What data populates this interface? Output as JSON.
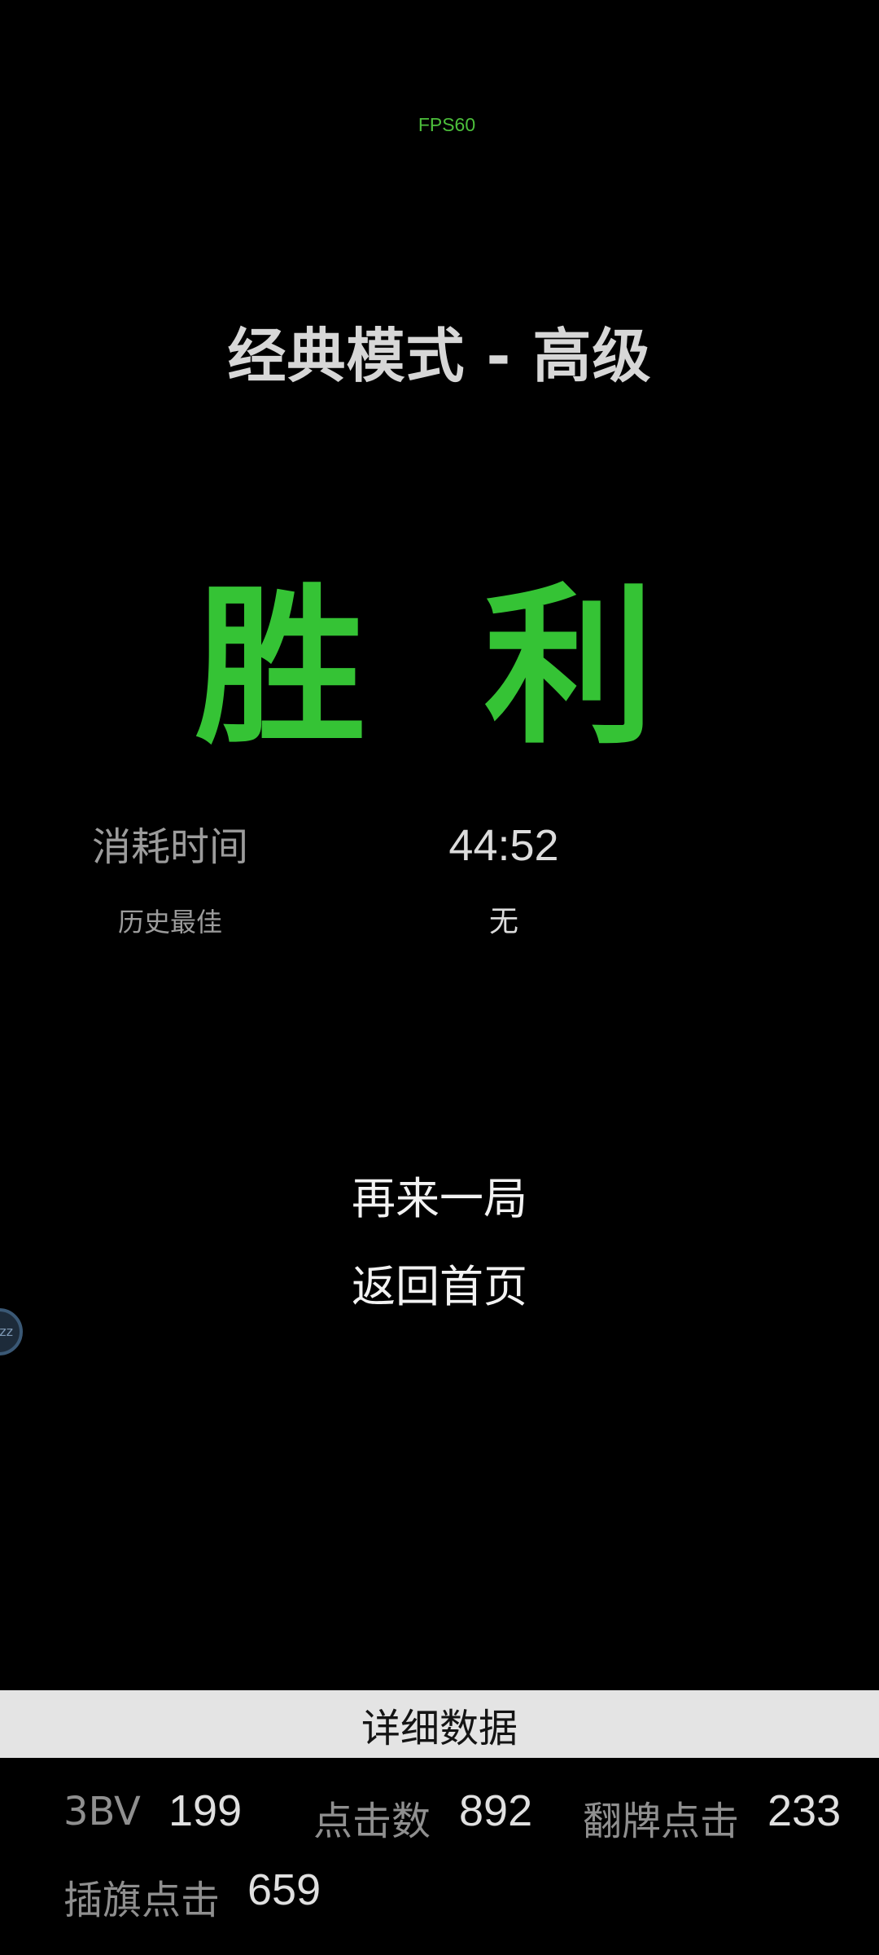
{
  "header": {
    "fps": "FPS60",
    "mode_title": "经典模式 - 高级"
  },
  "result": {
    "title": "胜 利"
  },
  "stats": {
    "time_label": "消耗时间",
    "time_value": "44:52",
    "best_label": "历史最佳",
    "best_value": "无"
  },
  "menu": {
    "play_again": "再来一局",
    "back_home": "返回首页"
  },
  "floating_ball": {
    "text": "zz"
  },
  "details": {
    "bar_label": "详细数据",
    "metrics": [
      {
        "label": "3BV",
        "value": "199"
      },
      {
        "label": "点击数",
        "value": "892"
      },
      {
        "label": "翻牌点击",
        "value": "233"
      },
      {
        "label": "插旗点击",
        "value": "659"
      }
    ]
  },
  "colors": {
    "background": "#000000",
    "win_green": "#35c335",
    "fps_green": "#4cbf3b",
    "detail_bar": "#e4e4e4"
  }
}
